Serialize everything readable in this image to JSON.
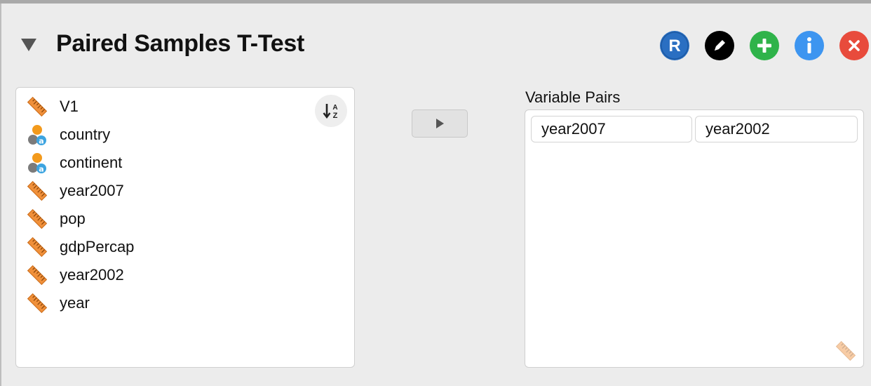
{
  "header": {
    "title": "Paired Samples T-Test",
    "buttons": [
      {
        "name": "r-syntax-button",
        "glyph": "R",
        "color": "#2a6fc2"
      },
      {
        "name": "edit-title-button",
        "icon": "pencil-icon",
        "color": "#000000"
      },
      {
        "name": "duplicate-button",
        "icon": "plus-icon",
        "color": "#2fb34a"
      },
      {
        "name": "info-button",
        "glyph": "i",
        "color": "#3d95f0"
      },
      {
        "name": "close-button",
        "icon": "close-icon",
        "color": "#e84b3c"
      }
    ]
  },
  "variables": {
    "sort_icon": "sort-alpha-icon",
    "items": [
      {
        "label": "V1",
        "type": "scale"
      },
      {
        "label": "country",
        "type": "nominal-text"
      },
      {
        "label": "continent",
        "type": "nominal-text"
      },
      {
        "label": "year2007",
        "type": "scale"
      },
      {
        "label": "pop",
        "type": "scale"
      },
      {
        "label": "gdpPercap",
        "type": "scale"
      },
      {
        "label": "year2002",
        "type": "scale"
      },
      {
        "label": "year",
        "type": "scale"
      }
    ]
  },
  "move_button": {
    "icon": "play-arrow-icon"
  },
  "pairs": {
    "label": "Variable Pairs",
    "rows": [
      {
        "var1": "year2007",
        "var2": "year2002"
      }
    ],
    "allowed_icon": "scale-ruler-icon"
  },
  "colors": {
    "ruler": "#f0903a",
    "nominal_top": "#f39a1c",
    "nominal_bottom": "#7b7b7b",
    "text_badge": "#3ca4e0"
  }
}
